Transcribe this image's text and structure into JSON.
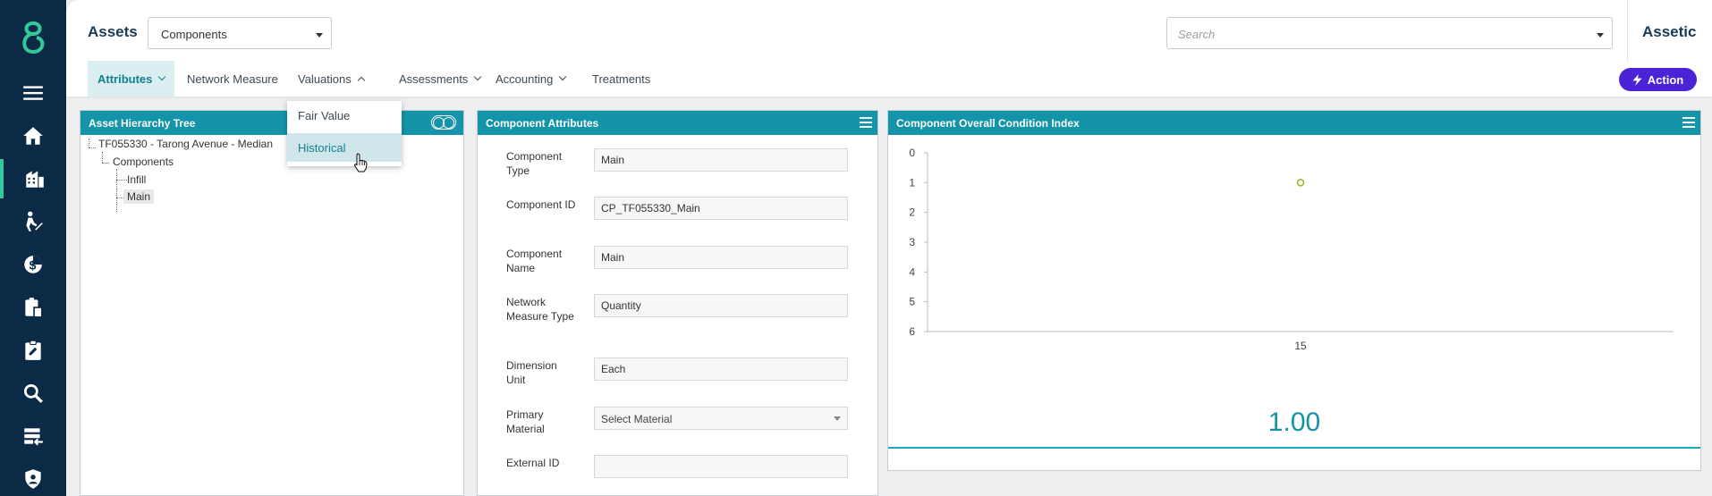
{
  "header": {
    "title": "Assets",
    "module_select_value": "Components",
    "search_placeholder": "Search",
    "brand": "Assetic"
  },
  "sidebar": {
    "items": [
      {
        "icon": "menu-icon"
      },
      {
        "icon": "home-icon"
      },
      {
        "icon": "buildings-icon",
        "active": true
      },
      {
        "icon": "worker-icon"
      },
      {
        "icon": "finance-icon"
      },
      {
        "icon": "clipboard-icon"
      },
      {
        "icon": "assignment-icon"
      },
      {
        "icon": "search-icon"
      },
      {
        "icon": "import-icon"
      },
      {
        "icon": "shield-user-icon"
      }
    ],
    "accent_color": "#35c89a",
    "background": "#0b2a45"
  },
  "nav": {
    "items": [
      {
        "label": "Attributes",
        "active": true,
        "chevron": "down"
      },
      {
        "label": "Network Measure"
      },
      {
        "label": "Valuations",
        "chevron": "up"
      },
      {
        "label": "Assessments",
        "chevron": "down"
      },
      {
        "label": "Accounting",
        "chevron": "down"
      },
      {
        "label": "Treatments"
      }
    ],
    "action_label": "Action"
  },
  "valuations_dropdown": {
    "items": [
      {
        "label": "Fair Value"
      },
      {
        "label": "Historical",
        "hover": true
      }
    ]
  },
  "tree_panel": {
    "title": "Asset Hierarchy Tree",
    "root": "TF055330 - Tarong Avenue - Median",
    "group": "Components",
    "children": [
      "Infill",
      "Main"
    ],
    "selected": "Main"
  },
  "attributes_panel": {
    "title": "Component Attributes",
    "fields": [
      {
        "label": "Component Type",
        "value": "Main"
      },
      {
        "label": "Component ID",
        "value": "CP_TF055330_Main"
      },
      {
        "label": "Component Name",
        "value": "Main"
      },
      {
        "label": "Network Measure Type",
        "value": "Quantity"
      },
      {
        "label": "Dimension Unit",
        "value": "Each"
      },
      {
        "label": "Primary Material",
        "value": "Select Material",
        "type": "select"
      },
      {
        "label": "External ID",
        "value": ""
      }
    ]
  },
  "condition_panel": {
    "title": "Component Overall Condition Index",
    "value_display": "1.00"
  },
  "chart_data": {
    "type": "scatter",
    "title": "",
    "xlabel": "",
    "ylabel": "",
    "x_categories": [
      "15"
    ],
    "y_ticks": [
      0,
      1,
      2,
      3,
      4,
      5,
      6
    ],
    "y_inverted": true,
    "ylim": [
      0,
      6
    ],
    "points": [
      {
        "x": "15",
        "y": 1
      }
    ],
    "marker_color": "#9aba2a",
    "grid": false
  },
  "colors": {
    "panel_header": "#1394a8",
    "action_button": "#4a23d6",
    "brand_text": "#1a3a55"
  }
}
